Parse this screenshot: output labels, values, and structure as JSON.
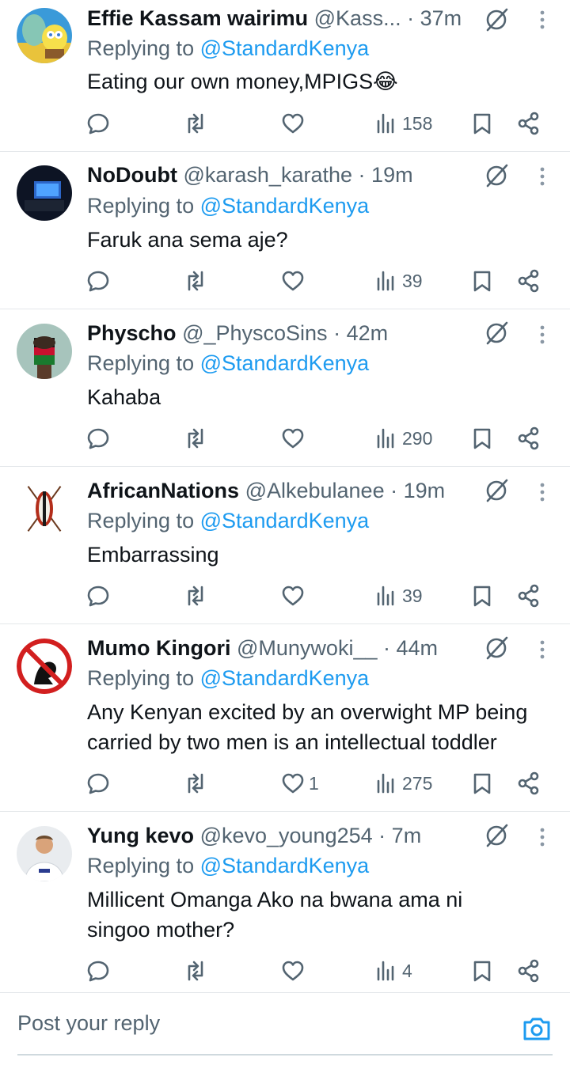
{
  "colors": {
    "accent": "#1d9bf0",
    "muted": "#536471",
    "text": "#0f1419",
    "divider": "#e4e7ea"
  },
  "replies": [
    {
      "name": "Effie Kassam wairimu",
      "handle": "@Kass...",
      "dot": "·",
      "time": "37m",
      "replying_label": "Replying to",
      "replying_to": "@StandardKenya",
      "text": "Eating our own money,MPIGS😂",
      "likes": "",
      "views": "158",
      "avatar": "spongebob-squidward-avatar"
    },
    {
      "name": "NoDoubt",
      "handle": "@karash_karathe",
      "dot": "·",
      "time": "19m",
      "replying_label": "Replying to",
      "replying_to": "@StandardKenya",
      "text": "Faruk ana sema aje?",
      "likes": "",
      "views": "39",
      "avatar": "dark-room-tv-avatar"
    },
    {
      "name": "Physcho",
      "handle": "@_PhyscoSins",
      "dot": "·",
      "time": "42m",
      "replying_label": "Replying to",
      "replying_to": "@StandardKenya",
      "text": "Kahaba",
      "likes": "",
      "views": "290",
      "avatar": "kenya-flag-fist-avatar"
    },
    {
      "name": "AfricanNations",
      "handle": "@Alkebulanee",
      "dot": "·",
      "time": "19m",
      "replying_label": "Replying to",
      "replying_to": "@StandardKenya",
      "text": "Embarrassing",
      "likes": "",
      "views": "39",
      "avatar": "maasai-shield-avatar"
    },
    {
      "name": "Mumo Kingori",
      "handle": "@Munywoki__",
      "dot": "·",
      "time": "44m",
      "replying_label": "Replying to",
      "replying_to": "@StandardKenya",
      "text": "Any Kenyan excited by an overwight MP being carried by two men is an intellectual toddler",
      "likes": "1",
      "views": "275",
      "avatar": "no-sign-profile-avatar"
    },
    {
      "name": "Yung kevo",
      "handle": "@kevo_young254",
      "dot": "·",
      "time": "7m",
      "replying_label": "Replying to",
      "replying_to": "@StandardKenya",
      "text": "Millicent Omanga Ako na bwana ama ni singoo mother?",
      "likes": "",
      "views": "4",
      "avatar": "man-white-jersey-avatar"
    }
  ],
  "composer": {
    "placeholder": "Post your reply",
    "camera_icon": "camera-icon"
  }
}
